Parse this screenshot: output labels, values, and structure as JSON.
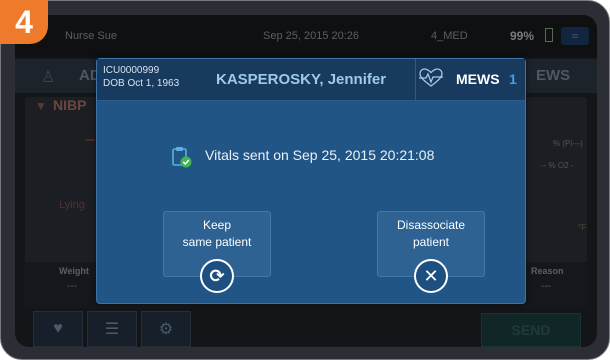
{
  "step_number": "4",
  "status_bar": {
    "user": "Nurse Sue",
    "datetime": "Sep 25, 2015  20:26",
    "med": "4_MED",
    "battery": "99%"
  },
  "background": {
    "tab_left_partial": "AD",
    "tab_right_partial": "EWS",
    "nibp_label": "NIBP",
    "position_label": "Lying",
    "spo2_pct_unit": "% (Pi---)",
    "o2_pct_unit": "-- % O2 -",
    "temp_unit": "°F",
    "weight_label": "Weight",
    "weight_value": "---",
    "reason_label": "Reason",
    "reason_value": "---",
    "send_label": "SEND"
  },
  "modal": {
    "patient_id": "ICU0000999",
    "dob": "DOB  Oct 1, 1963",
    "patient_name": "KASPEROSKY, Jennifer",
    "mews_label": "MEWS",
    "mews_score": "1",
    "message": "Vitals sent on Sep 25, 2015  20:21:08",
    "keep_button": {
      "line1": "Keep",
      "line2": "same patient"
    },
    "disassociate_button": {
      "line1": "Disassociate",
      "line2": "patient"
    }
  },
  "colors": {
    "accent_orange": "#ee7a2c",
    "modal_blue": "#215585",
    "header_blue": "#173a5e",
    "mews_score_blue": "#4f9ad8",
    "check_green": "#3fb652"
  },
  "icons": [
    "person-icon",
    "heart-monitor-icon",
    "clipboard-check-icon",
    "refresh-icon",
    "close-icon",
    "vitals-nav-icon",
    "list-nav-icon",
    "settings-nav-icon",
    "wifi-icon",
    "battery-icon"
  ]
}
